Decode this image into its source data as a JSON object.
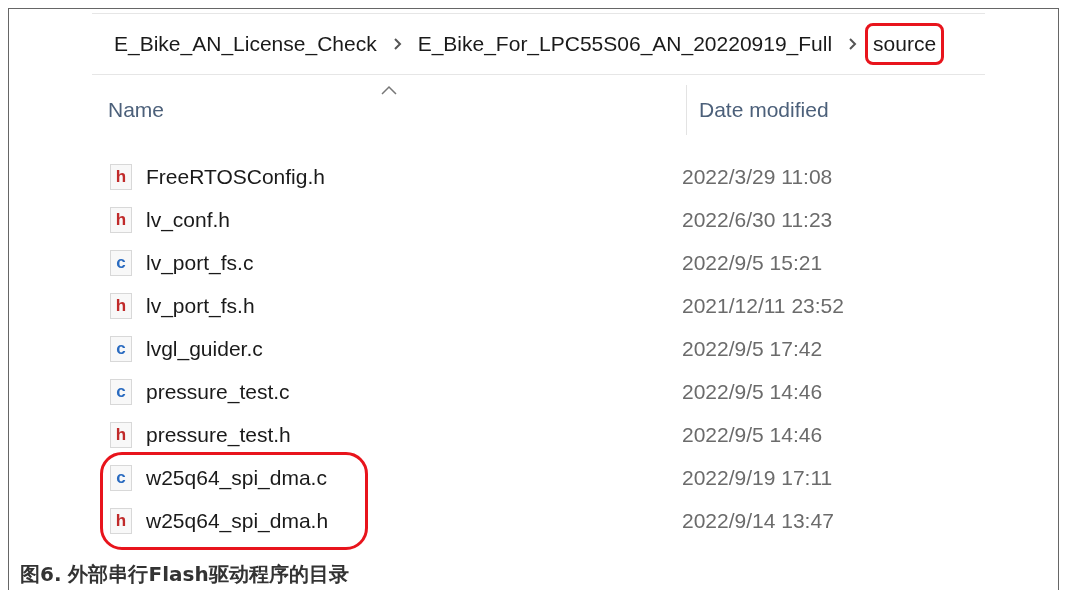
{
  "breadcrumb": [
    {
      "label": "E_Bike_AN_License_Check",
      "highlighted": false
    },
    {
      "label": "E_Bike_For_LPC55S06_AN_20220919_Full",
      "highlighted": false
    },
    {
      "label": "source",
      "highlighted": true
    }
  ],
  "columns": [
    {
      "label": "Name",
      "sorted": true
    },
    {
      "label": "Date modified",
      "sorted": false
    }
  ],
  "files": [
    {
      "name": "FreeRTOSConfig.h",
      "date": "2022/3/29 11:08",
      "kind": "header",
      "icon_text": "h",
      "highlighted": false
    },
    {
      "name": "lv_conf.h",
      "date": "2022/6/30 11:23",
      "kind": "header",
      "icon_text": "h",
      "highlighted": false
    },
    {
      "name": "lv_port_fs.c",
      "date": "2022/9/5 15:21",
      "kind": "source",
      "icon_text": "c",
      "highlighted": false
    },
    {
      "name": "lv_port_fs.h",
      "date": "2021/12/11 23:52",
      "kind": "header",
      "icon_text": "h",
      "highlighted": false
    },
    {
      "name": "lvgl_guider.c",
      "date": "2022/9/5 17:42",
      "kind": "source",
      "icon_text": "c",
      "highlighted": false
    },
    {
      "name": "pressure_test.c",
      "date": "2022/9/5 14:46",
      "kind": "source",
      "icon_text": "c",
      "highlighted": false
    },
    {
      "name": "pressure_test.h",
      "date": "2022/9/5 14:46",
      "kind": "header",
      "icon_text": "h",
      "highlighted": false
    },
    {
      "name": "w25q64_spi_dma.c",
      "date": "2022/9/19 17:11",
      "kind": "source",
      "icon_text": "c",
      "highlighted": true
    },
    {
      "name": "w25q64_spi_dma.h",
      "date": "2022/9/14 13:47",
      "kind": "header",
      "icon_text": "h",
      "highlighted": true
    }
  ],
  "caption": "图6. 外部串行Flash驱动程序的目录"
}
